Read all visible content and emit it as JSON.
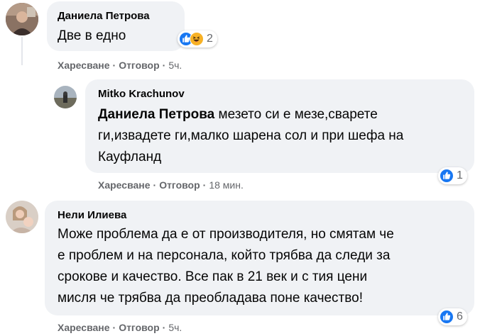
{
  "comments": [
    {
      "author": "Даниела Петрова",
      "text": "Две в едно",
      "actions": {
        "like": "Харесване",
        "reply": "Отговор",
        "time": "5ч."
      },
      "reactions": {
        "types": [
          "like-icon",
          "haha-icon"
        ],
        "count": "2"
      }
    },
    {
      "author": "Mitko Krachunov",
      "mention": "Даниела Петрова",
      "text_line1": " мезето си е мезе,сварете",
      "text_line2": "ги,извадете ги,малко шарена сол и при шефа на",
      "text_line3": "Кауфланд",
      "actions": {
        "like": "Харесване",
        "reply": "Отговор",
        "time": "18 мин."
      },
      "reactions": {
        "types": [
          "like-icon"
        ],
        "count": "1"
      }
    },
    {
      "author": "Нели Илиева",
      "text_line1": "Може проблема да е от производителя, но смятам че",
      "text_line2": "е проблем и на персонала, който трябва да следи за",
      "text_line3": "срокове и качество. Все пак в 21 век и с тия цени",
      "text_line4": "мисля че трябва да преобладава поне качество!",
      "actions": {
        "like": "Харесване",
        "reply": "Отговор",
        "time": "5ч."
      },
      "reactions": {
        "types": [
          "like-icon"
        ],
        "count": "6"
      }
    }
  ],
  "separator": "·",
  "colors": {
    "bubble": "#f0f2f5",
    "meta": "#65676b",
    "like": "#1877f2",
    "haha": "#f7b125"
  }
}
